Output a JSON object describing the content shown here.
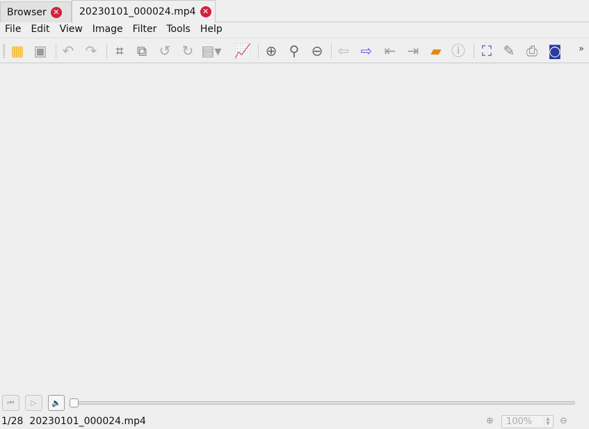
{
  "tabs": [
    {
      "label": "Browser",
      "close": "✕"
    },
    {
      "label": "20230101_000024.mp4",
      "close": "✕"
    }
  ],
  "menu": [
    "File",
    "Edit",
    "View",
    "Image",
    "Filter",
    "Tools",
    "Help"
  ],
  "toolbar": [
    {
      "name": "browser-tree-icon",
      "color": "#f2b418",
      "glyph": "▦"
    },
    {
      "name": "save-icon",
      "color": "#9a9a9a",
      "glyph": "▣"
    },
    {
      "sep": true
    },
    {
      "name": "undo-icon",
      "color": "#b0b0b0",
      "glyph": "↶"
    },
    {
      "name": "redo-icon",
      "color": "#b0b0b0",
      "glyph": "↷"
    },
    {
      "sep": true
    },
    {
      "name": "crop-icon",
      "color": "#666",
      "glyph": "⌗"
    },
    {
      "name": "resize-icon",
      "color": "#777",
      "glyph": "⧉"
    },
    {
      "name": "rotate-left-icon",
      "color": "#aaa",
      "glyph": "↺"
    },
    {
      "name": "rotate-right-icon",
      "color": "#aaa",
      "glyph": "↻"
    },
    {
      "name": "adjust-dropdown-icon",
      "color": "#999",
      "glyph": "▤▾"
    },
    {
      "name": "histogram-icon",
      "color": "#777",
      "glyph": "📈"
    },
    {
      "sep": true
    },
    {
      "name": "zoom-in-icon",
      "color": "#666",
      "glyph": "⊕"
    },
    {
      "name": "zoom-actual-icon",
      "color": "#666",
      "glyph": "⚲"
    },
    {
      "name": "zoom-out-icon",
      "color": "#666",
      "glyph": "⊖"
    },
    {
      "sep": true
    },
    {
      "name": "previous-icon",
      "color": "#bbb",
      "glyph": "⇦"
    },
    {
      "name": "next-icon",
      "color": "#5a62d8",
      "glyph": "⇨"
    },
    {
      "name": "first-icon",
      "color": "#999",
      "glyph": "⇤"
    },
    {
      "name": "last-icon",
      "color": "#999",
      "glyph": "⇥"
    },
    {
      "name": "slideshow-icon",
      "color": "#e08a10",
      "glyph": "▰"
    },
    {
      "name": "properties-icon",
      "color": "#aaa",
      "glyph": "ⓘ"
    },
    {
      "sep": true
    },
    {
      "name": "fullscreen-icon",
      "color": "#2a3a9a",
      "glyph": "⛶"
    },
    {
      "name": "tools-icon",
      "color": "#888",
      "glyph": "✎"
    },
    {
      "name": "print-icon",
      "color": "#888",
      "glyph": "⎙"
    },
    {
      "name": "screenshot-icon",
      "color": "#2a3aa0",
      "glyph": "◙"
    }
  ],
  "more": "»",
  "player": {
    "first": "⏮",
    "play": "▷",
    "volume": "🔈"
  },
  "status": {
    "text": "1/28  20230101_000024.mp4",
    "zoom": "100%",
    "zoom_in": "⊕",
    "zoom_out": "⊖"
  }
}
